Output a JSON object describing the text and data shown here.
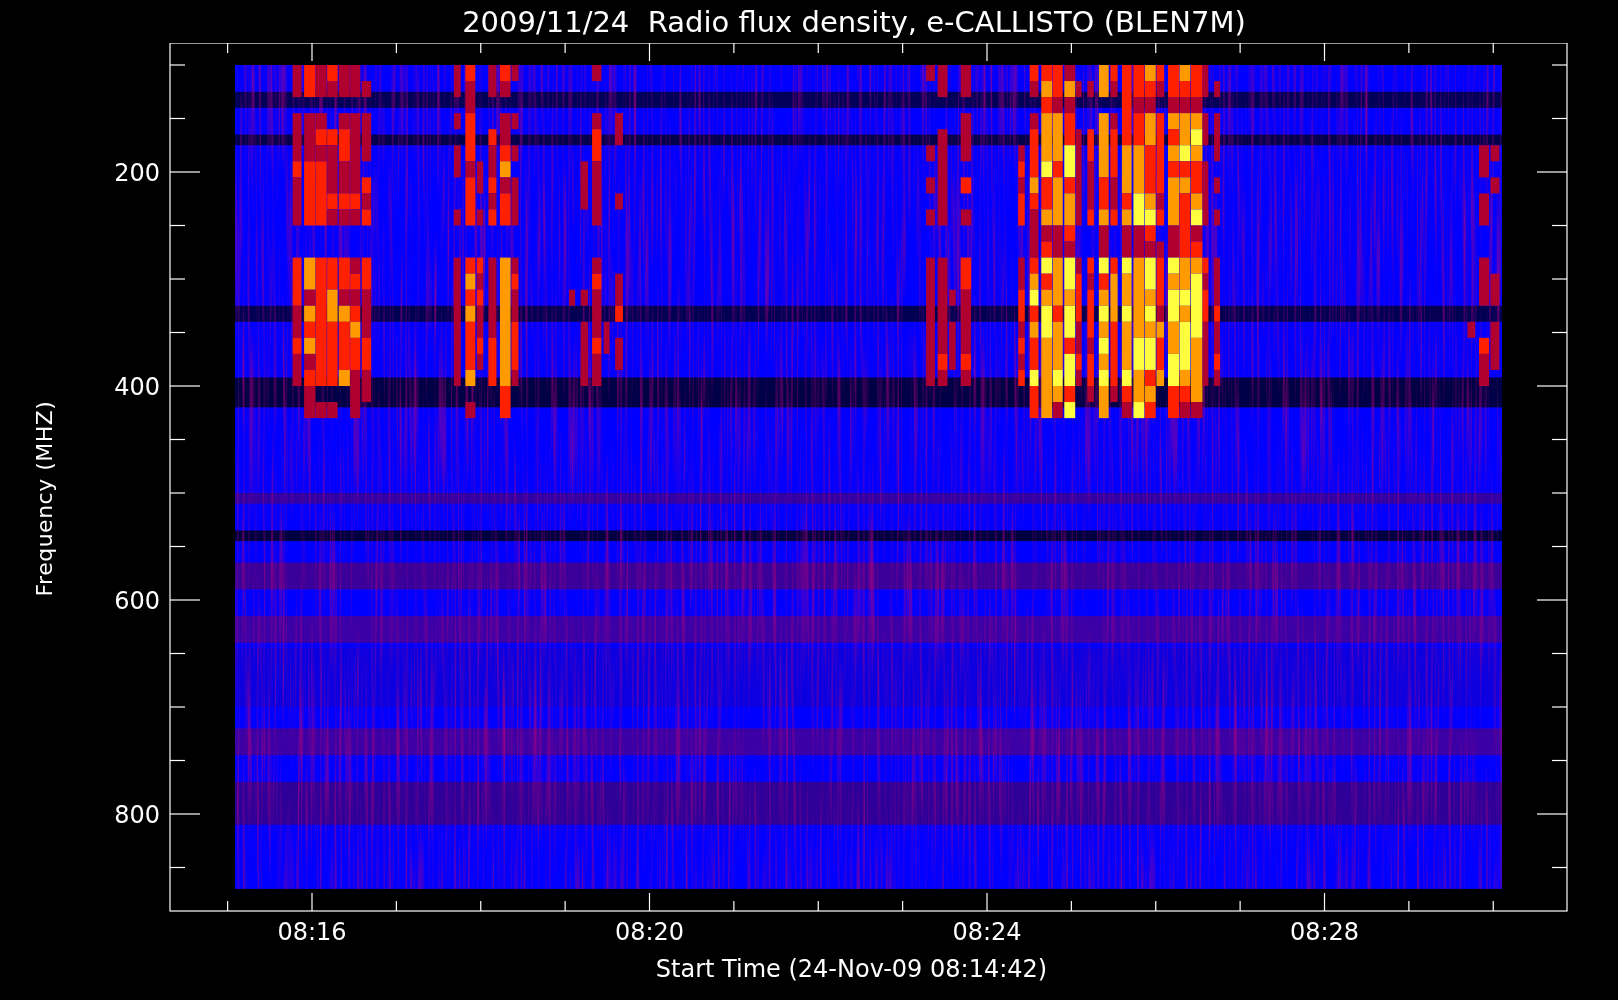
{
  "title": "2009/11/24  Radio flux density, e-CALLISTO (BLEN7M)",
  "y_axis": {
    "label": "Frequency (MHZ)",
    "ticks": [
      "200",
      "400",
      "600",
      "800"
    ]
  },
  "x_axis": {
    "label": "Start Time (24-Nov-09 08:14:42)",
    "ticks": [
      "08:16",
      "08:20",
      "08:24",
      "08:28"
    ]
  }
}
